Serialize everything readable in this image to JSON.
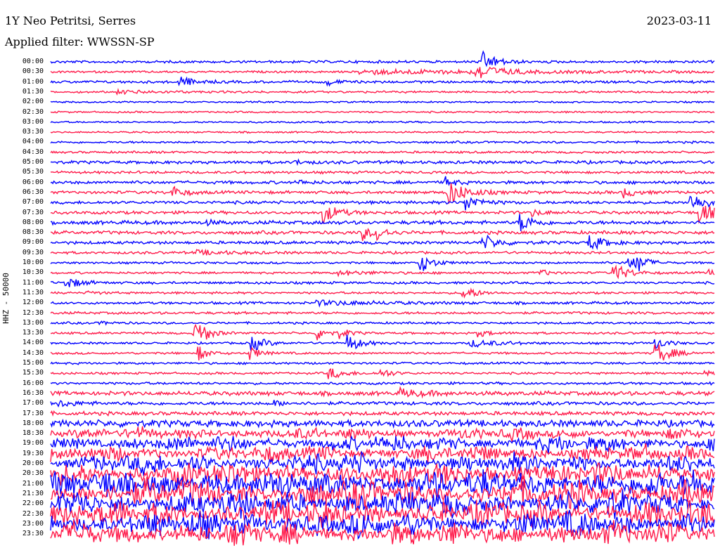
{
  "header": {
    "station": "1Y Neo Petritsi, Serres",
    "date": "2023-03-11",
    "filter": "Applied filter: WWSSN-SP"
  },
  "chart_data": {
    "type": "line",
    "title": "1Y Neo Petritsi, Serres",
    "ylabel": "HHZ - 50000",
    "x_unit": "minutes",
    "xlim": [
      0,
      30
    ],
    "colors": [
      "#0000ff",
      "#ff1a4a"
    ],
    "rows": [
      {
        "label": "00:00",
        "noise": 1.5,
        "events": [
          [
            19.5,
            14,
            0.6
          ]
        ]
      },
      {
        "label": "00:30",
        "noise": 1.2,
        "events": [
          [
            19.2,
            12,
            0.8
          ],
          [
            14,
            3,
            8
          ]
        ]
      },
      {
        "label": "01:00",
        "noise": 1.5,
        "events": [
          [
            5.8,
            8,
            0.6
          ],
          [
            12.5,
            5,
            0.4
          ]
        ]
      },
      {
        "label": "01:30",
        "noise": 1.2,
        "events": [
          [
            3,
            2,
            2
          ]
        ]
      },
      {
        "label": "02:00",
        "noise": 1.0,
        "events": []
      },
      {
        "label": "02:30",
        "noise": 1.0,
        "events": []
      },
      {
        "label": "03:00",
        "noise": 1.0,
        "events": []
      },
      {
        "label": "03:30",
        "noise": 1.0,
        "events": []
      },
      {
        "label": "04:00",
        "noise": 1.3,
        "events": []
      },
      {
        "label": "04:30",
        "noise": 1.3,
        "events": []
      },
      {
        "label": "05:00",
        "noise": 1.8,
        "events": [
          [
            11,
            3,
            0.5
          ]
        ]
      },
      {
        "label": "05:30",
        "noise": 1.5,
        "events": []
      },
      {
        "label": "06:00",
        "noise": 1.8,
        "events": [
          [
            17.8,
            8,
            0.4
          ],
          [
            11.2,
            3,
            0.4
          ]
        ]
      },
      {
        "label": "06:30",
        "noise": 1.8,
        "events": [
          [
            5.5,
            8,
            0.5
          ],
          [
            17.9,
            20,
            0.7
          ],
          [
            25.9,
            7,
            0.5
          ]
        ]
      },
      {
        "label": "07:00",
        "noise": 1.8,
        "events": [
          [
            18.7,
            12,
            0.6
          ],
          [
            28.9,
            12,
            0.8
          ]
        ]
      },
      {
        "label": "07:30",
        "noise": 1.8,
        "events": [
          [
            12.3,
            14,
            0.6
          ],
          [
            21.7,
            5,
            0.5
          ],
          [
            29.3,
            16,
            0.6
          ]
        ]
      },
      {
        "label": "08:00",
        "noise": 2.2,
        "events": [
          [
            21.2,
            14,
            0.5
          ],
          [
            6.9,
            4,
            0.4
          ]
        ]
      },
      {
        "label": "08:30",
        "noise": 2.0,
        "events": [
          [
            14.1,
            10,
            0.4
          ],
          [
            14.7,
            10,
            0.4
          ]
        ]
      },
      {
        "label": "09:00",
        "noise": 1.8,
        "events": [
          [
            19.5,
            12,
            0.6
          ],
          [
            24.3,
            12,
            0.6
          ]
        ]
      },
      {
        "label": "09:30",
        "noise": 1.5,
        "events": [
          [
            6.6,
            3,
            1.5
          ]
        ]
      },
      {
        "label": "10:00",
        "noise": 1.3,
        "events": [
          [
            16.7,
            14,
            0.5
          ],
          [
            26,
            12,
            0.4
          ],
          [
            26.5,
            12,
            0.4
          ]
        ]
      },
      {
        "label": "10:30",
        "noise": 1.3,
        "events": [
          [
            25.4,
            14,
            0.6
          ],
          [
            22.1,
            5,
            0.4
          ],
          [
            29.7,
            5,
            0.3
          ],
          [
            13,
            3,
            1.5
          ]
        ]
      },
      {
        "label": "11:00",
        "noise": 1.5,
        "events": [
          [
            0.7,
            8,
            0.6
          ]
        ]
      },
      {
        "label": "11:30",
        "noise": 1.3,
        "events": [
          [
            18.6,
            12,
            0.5
          ],
          [
            1.7,
            3,
            0.4
          ]
        ]
      },
      {
        "label": "12:00",
        "noise": 1.5,
        "events": [
          [
            12,
            3,
            3
          ]
        ]
      },
      {
        "label": "12:30",
        "noise": 1.5,
        "events": []
      },
      {
        "label": "13:00",
        "noise": 1.3,
        "events": [
          [
            2.2,
            2,
            0.6
          ]
        ]
      },
      {
        "label": "13:30",
        "noise": 1.3,
        "events": [
          [
            6.5,
            12,
            0.4
          ],
          [
            6.8,
            10,
            0.4
          ],
          [
            12,
            12,
            0.4
          ],
          [
            13.1,
            6,
            0.4
          ],
          [
            19.3,
            5,
            0.5
          ]
        ]
      },
      {
        "label": "14:00",
        "noise": 1.3,
        "events": [
          [
            9.1,
            12,
            0.5
          ],
          [
            13.4,
            14,
            0.5
          ],
          [
            19,
            5,
            1.2
          ],
          [
            27.3,
            8,
            0.5
          ]
        ]
      },
      {
        "label": "14:30",
        "noise": 1.3,
        "events": [
          [
            6.7,
            10,
            0.4
          ],
          [
            9,
            10,
            0.4
          ],
          [
            27.3,
            18,
            0.6
          ]
        ]
      },
      {
        "label": "15:00",
        "noise": 1.3,
        "events": []
      },
      {
        "label": "15:30",
        "noise": 1.3,
        "events": [
          [
            12.6,
            8,
            0.6
          ],
          [
            14.9,
            8,
            0.4
          ],
          [
            29.5,
            3,
            0.4
          ]
        ]
      },
      {
        "label": "16:00",
        "noise": 1.5,
        "events": []
      },
      {
        "label": "16:30",
        "noise": 2.5,
        "events": [
          [
            15.8,
            5,
            1
          ],
          [
            30,
            8,
            0.3
          ]
        ]
      },
      {
        "label": "17:00",
        "noise": 2.0,
        "events": [
          [
            0.3,
            4,
            0.8
          ],
          [
            10,
            4,
            0.5
          ]
        ]
      },
      {
        "label": "17:30",
        "noise": 2.2,
        "events": []
      },
      {
        "label": "18:00",
        "noise": 4,
        "events": []
      },
      {
        "label": "18:30",
        "noise": 6,
        "events": []
      },
      {
        "label": "19:00",
        "noise": 8,
        "events": []
      },
      {
        "label": "19:30",
        "noise": 8,
        "events": []
      },
      {
        "label": "20:00",
        "noise": 10,
        "events": []
      },
      {
        "label": "20:30",
        "noise": 12,
        "events": []
      },
      {
        "label": "21:00",
        "noise": 14,
        "events": []
      },
      {
        "label": "21:30",
        "noise": 14,
        "events": []
      },
      {
        "label": "22:00",
        "noise": 13,
        "events": []
      },
      {
        "label": "22:30",
        "noise": 13,
        "events": []
      },
      {
        "label": "23:00",
        "noise": 13,
        "events": []
      },
      {
        "label": "23:30",
        "noise": 12,
        "events": []
      }
    ]
  }
}
